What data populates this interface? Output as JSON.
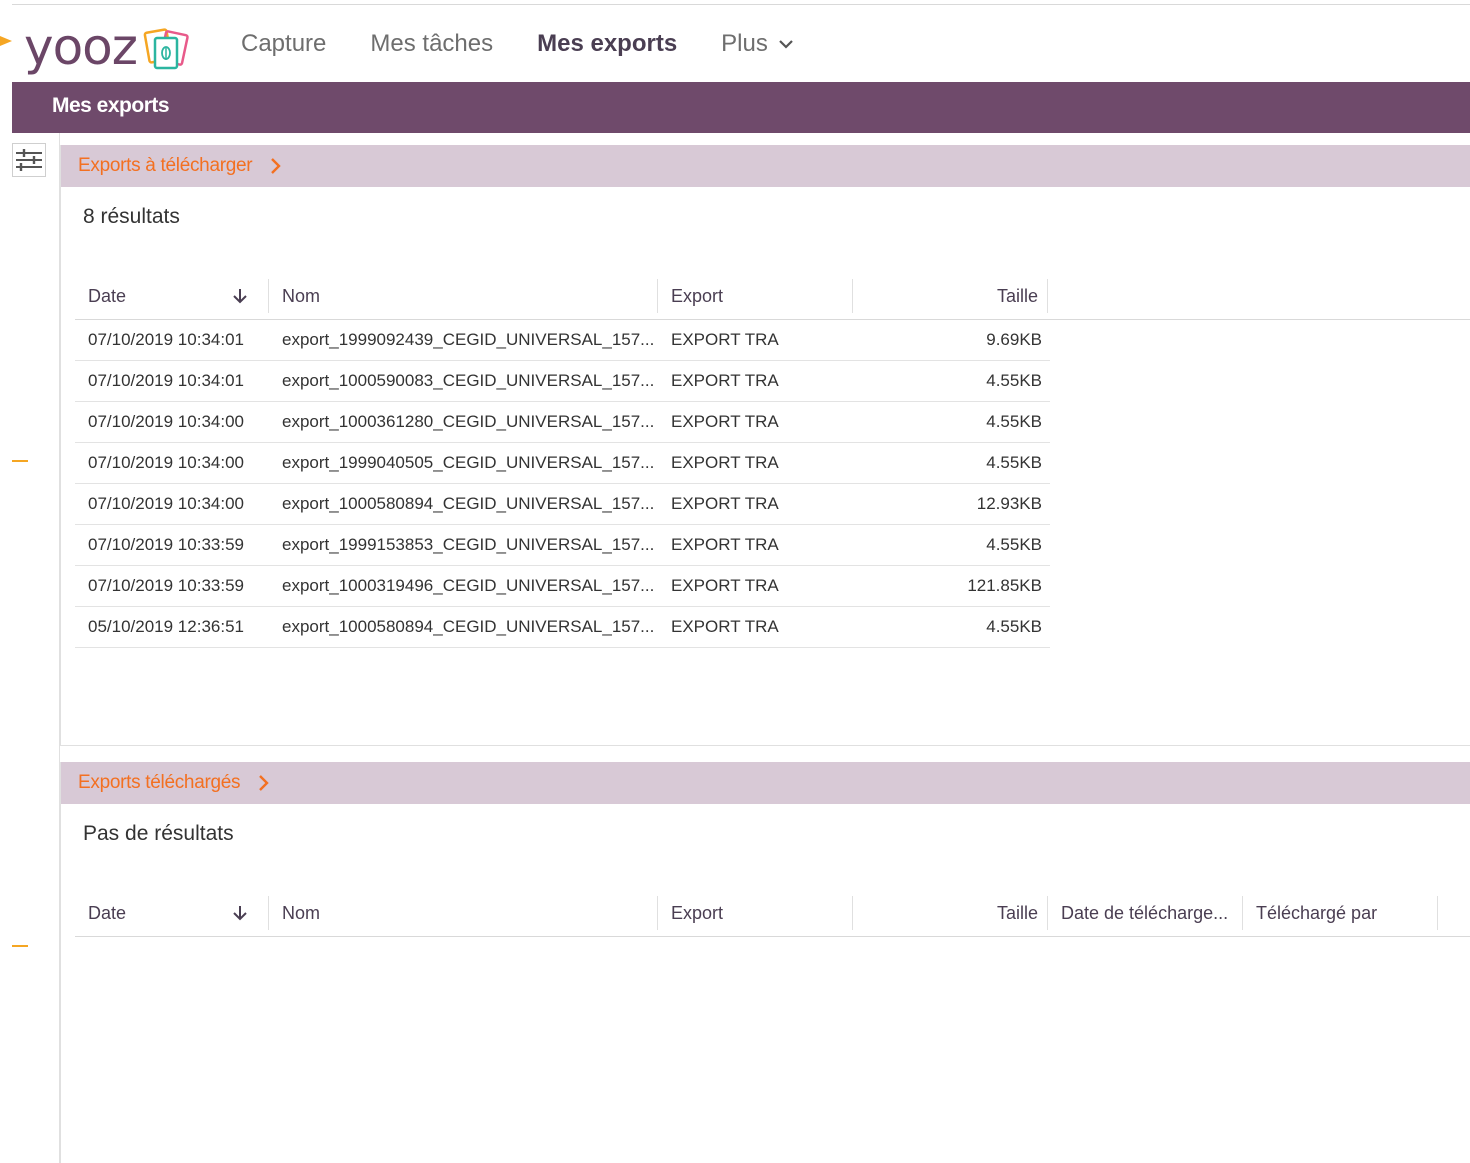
{
  "brand": {
    "name": "yooz"
  },
  "nav": {
    "items": [
      {
        "label": "Capture",
        "active": false
      },
      {
        "label": "Mes tâches",
        "active": false
      },
      {
        "label": "Mes exports",
        "active": true
      }
    ],
    "more_label": "Plus"
  },
  "page": {
    "title": "Mes exports"
  },
  "colors": {
    "brand_purple": "#6f4a6b",
    "accent_orange": "#f37021",
    "section_bg": "#d8c9d6"
  },
  "to_download": {
    "title": "Exports à télécharger",
    "result_count": "8 résultats",
    "columns": {
      "date": "Date",
      "name": "Nom",
      "export": "Export",
      "size": "Taille"
    },
    "rows": [
      {
        "date": "07/10/2019 10:34:01",
        "name": "export_1999092439_CEGID_UNIVERSAL_157...",
        "export": "EXPORT TRA",
        "size": "9.69KB"
      },
      {
        "date": "07/10/2019 10:34:01",
        "name": "export_1000590083_CEGID_UNIVERSAL_157...",
        "export": "EXPORT TRA",
        "size": "4.55KB"
      },
      {
        "date": "07/10/2019 10:34:00",
        "name": "export_1000361280_CEGID_UNIVERSAL_157...",
        "export": "EXPORT TRA",
        "size": "4.55KB"
      },
      {
        "date": "07/10/2019 10:34:00",
        "name": "export_1999040505_CEGID_UNIVERSAL_157...",
        "export": "EXPORT TRA",
        "size": "4.55KB"
      },
      {
        "date": "07/10/2019 10:34:00",
        "name": "export_1000580894_CEGID_UNIVERSAL_157...",
        "export": "EXPORT TRA",
        "size": "12.93KB"
      },
      {
        "date": "07/10/2019 10:33:59",
        "name": "export_1999153853_CEGID_UNIVERSAL_157...",
        "export": "EXPORT TRA",
        "size": "4.55KB"
      },
      {
        "date": "07/10/2019 10:33:59",
        "name": "export_1000319496_CEGID_UNIVERSAL_157...",
        "export": "EXPORT TRA",
        "size": "121.85KB"
      },
      {
        "date": "05/10/2019 12:36:51",
        "name": "export_1000580894_CEGID_UNIVERSAL_157...",
        "export": "EXPORT TRA",
        "size": "4.55KB"
      }
    ]
  },
  "downloaded": {
    "title": "Exports téléchargés",
    "result_count": "Pas de résultats",
    "columns": {
      "date": "Date",
      "name": "Nom",
      "export": "Export",
      "size": "Taille",
      "download_date": "Date de télécharge...",
      "downloaded_by": "Téléchargé par"
    },
    "rows": []
  },
  "icons": {
    "sort": "arrow-down-icon",
    "section_toggle": "chevron-right-icon",
    "filter": "sliders-icon",
    "more": "chevron-down-icon"
  }
}
